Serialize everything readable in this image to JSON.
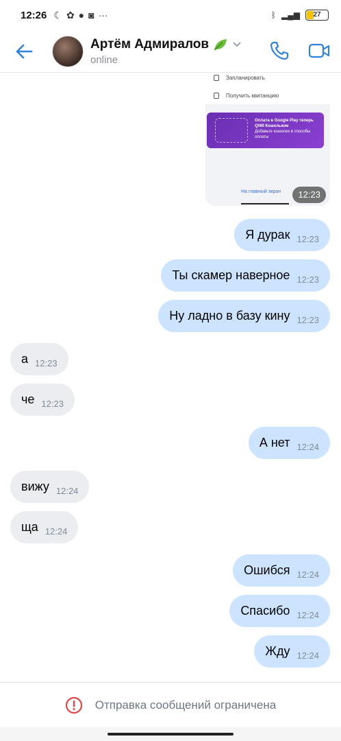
{
  "status_bar": {
    "time": "12:26",
    "battery": "27"
  },
  "header": {
    "contact_name": "Артём Адмиралов",
    "contact_status": "online"
  },
  "shared_screenshot": {
    "row1": "Запланировать",
    "row2": "Получить квитанцию",
    "card_title": "Оплата в Google Play теперь QIWI Кошельком",
    "card_text": "Добавьте кошелек в способы оплаты",
    "link": "На главный экран",
    "time": "12:23"
  },
  "messages": [
    {
      "dir": "out",
      "text": "Я дурак",
      "time": "12:23"
    },
    {
      "dir": "out",
      "text": "Ты скамер наверное",
      "time": "12:23"
    },
    {
      "dir": "out",
      "text": "Ну ладно в базу кину",
      "time": "12:23"
    },
    {
      "dir": "in",
      "text": "а",
      "time": "12:23"
    },
    {
      "dir": "in",
      "text": "че",
      "time": "12:23"
    },
    {
      "dir": "out",
      "text": "А нет",
      "time": "12:24"
    },
    {
      "dir": "in",
      "text": "вижу",
      "time": "12:24"
    },
    {
      "dir": "in",
      "text": "ща",
      "time": "12:24"
    },
    {
      "dir": "out",
      "text": "Ошибся",
      "time": "12:24"
    },
    {
      "dir": "out",
      "text": "Спасибо",
      "time": "12:24"
    },
    {
      "dir": "out",
      "text": "Жду",
      "time": "12:24"
    }
  ],
  "footer": {
    "restriction_text": "Отправка сообщений ограничена"
  },
  "colors": {
    "accent": "#2d81e0",
    "outgoing_bubble": "#cce4ff",
    "incoming_bubble": "#ebedf0",
    "error_red": "#e64646"
  }
}
